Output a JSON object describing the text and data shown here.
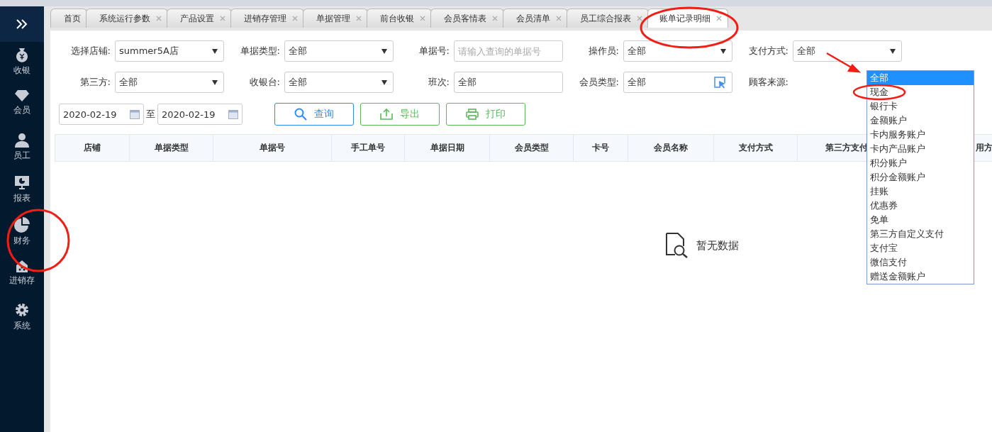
{
  "sidebar": {
    "items": [
      {
        "label": "收银",
        "kind": "money"
      },
      {
        "label": "会员",
        "kind": "diamond"
      },
      {
        "label": "员工",
        "kind": "person"
      },
      {
        "label": "报表",
        "kind": "monitor"
      },
      {
        "label": "财务",
        "kind": "pie"
      },
      {
        "label": "进销存",
        "kind": "house"
      },
      {
        "label": "系统",
        "kind": "gear"
      }
    ]
  },
  "tabs": [
    {
      "label": "首页",
      "selected": false,
      "closable": false
    },
    {
      "label": "系统运行参数",
      "selected": false,
      "closable": true
    },
    {
      "label": "产品设置",
      "selected": false,
      "closable": true
    },
    {
      "label": "进销存管理",
      "selected": false,
      "closable": true
    },
    {
      "label": "单据管理",
      "selected": false,
      "closable": true
    },
    {
      "label": "前台收银",
      "selected": false,
      "closable": true
    },
    {
      "label": "会员客情表",
      "selected": false,
      "closable": true
    },
    {
      "label": "会员清单",
      "selected": false,
      "closable": true
    },
    {
      "label": "员工综合报表",
      "selected": false,
      "closable": true
    },
    {
      "label": "账单记录明细",
      "selected": true,
      "closable": true
    }
  ],
  "filters": [
    {
      "label": "选择店铺:",
      "kind": "select",
      "value": "summer5A店"
    },
    {
      "label": "单据类型:",
      "kind": "select",
      "value": "全部"
    },
    {
      "label": "单据号:",
      "kind": "input",
      "placeholder": "请输入查询的单据号"
    },
    {
      "label": "操作员:",
      "kind": "select",
      "value": "全部"
    },
    {
      "label": "支付方式:",
      "kind": "select",
      "value": "全部"
    },
    {
      "label": "第三方:",
      "kind": "select",
      "value": "全部"
    },
    {
      "label": "收银台:",
      "kind": "select",
      "value": "全部"
    },
    {
      "label": "班次:",
      "kind": "plain",
      "value": "全部"
    },
    {
      "label": "会员类型:",
      "kind": "picker",
      "value": "全部"
    },
    {
      "label": "顾客来源:",
      "kind": "hidden"
    }
  ],
  "date_from": "2020-02-19",
  "date_sep": "至",
  "date_to": "2020-02-19",
  "buttons": [
    {
      "label": "查询",
      "kind": "search"
    },
    {
      "label": "导出",
      "kind": "export"
    },
    {
      "label": "打印",
      "kind": "print"
    }
  ],
  "table": {
    "columns": [
      "店铺",
      "单据类型",
      "单据号",
      "手工单号",
      "单据日期",
      "会员类型",
      "卡号",
      "会员名称",
      "支付方式",
      "第三方支付",
      "用方"
    ],
    "empty_text": "暂无数据"
  },
  "dropdown": {
    "options": [
      {
        "label": "全部",
        "selected": true
      },
      {
        "label": "现金",
        "selected": false
      },
      {
        "label": "银行卡",
        "selected": false
      },
      {
        "label": "金额账户",
        "selected": false
      },
      {
        "label": "卡内服务账户",
        "selected": false
      },
      {
        "label": "卡内产品账户",
        "selected": false
      },
      {
        "label": "积分账户",
        "selected": false
      },
      {
        "label": "积分金额账户",
        "selected": false
      },
      {
        "label": "挂账",
        "selected": false
      },
      {
        "label": "优惠券",
        "selected": false
      },
      {
        "label": "免单",
        "selected": false
      },
      {
        "label": "第三方自定义支付",
        "selected": false
      },
      {
        "label": "支付宝",
        "selected": false
      },
      {
        "label": "微信支付",
        "selected": false
      },
      {
        "label": "赠送金额账户",
        "selected": false
      }
    ]
  }
}
